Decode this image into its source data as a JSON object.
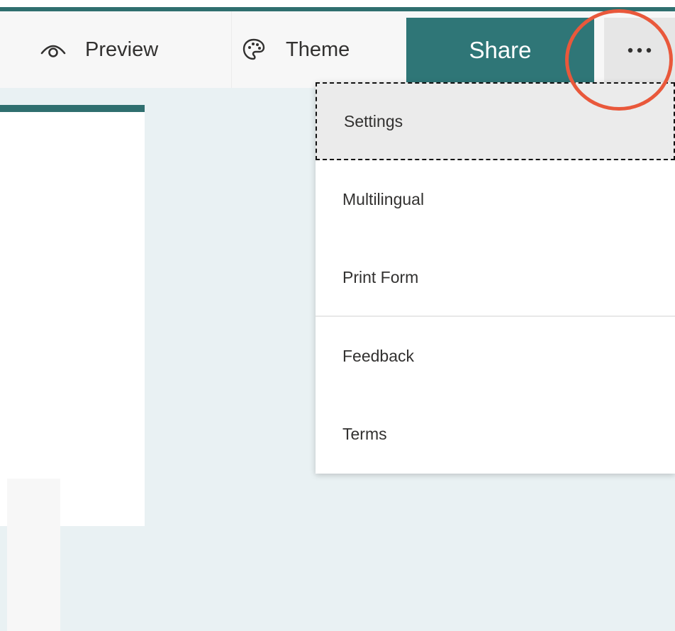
{
  "toolbar": {
    "preview_label": "Preview",
    "theme_label": "Theme",
    "share_label": "Share",
    "more_label": "•••",
    "icons": {
      "preview": "eye-icon",
      "theme": "palette-icon",
      "more": "more-options-icon"
    }
  },
  "menu": {
    "items": [
      {
        "label": "Settings"
      },
      {
        "label": "Multilingual"
      },
      {
        "label": "Print Form"
      },
      {
        "label": "Feedback"
      },
      {
        "label": "Terms"
      }
    ]
  },
  "colors": {
    "accent": "#2f7677",
    "annotation": "#e9583b",
    "canvas": "#e9f1f3"
  }
}
